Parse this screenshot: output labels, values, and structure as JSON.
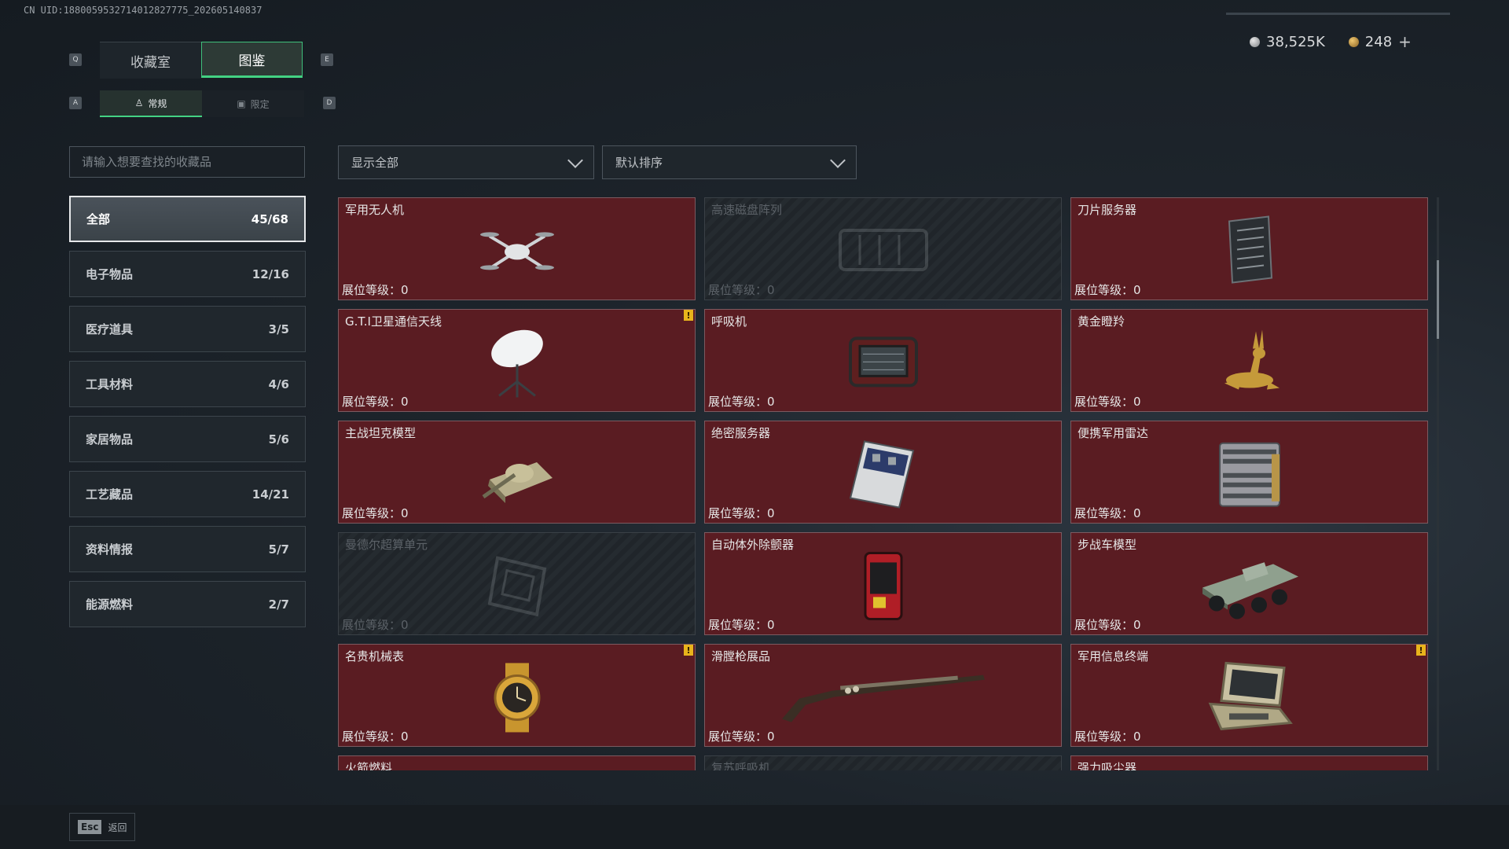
{
  "uid": "CN UID:1880059532714012827775_202605140837",
  "currency": {
    "silver": "38,525K",
    "gold": "248",
    "add": "+"
  },
  "keys": {
    "prev_tab": "Q",
    "next_tab": "E",
    "prev_sub": "A",
    "next_sub": "D"
  },
  "tabs": [
    {
      "label": "收藏室"
    },
    {
      "label": "图鉴"
    }
  ],
  "subtabs": [
    {
      "label": "常规"
    },
    {
      "label": "限定"
    }
  ],
  "search": {
    "placeholder": "请输入想要查找的收藏品"
  },
  "filters": {
    "show": "显示全部",
    "sort": "默认排序"
  },
  "categories": [
    {
      "label": "全部",
      "count": "45/68"
    },
    {
      "label": "电子物品",
      "count": "12/16"
    },
    {
      "label": "医疗道具",
      "count": "3/5"
    },
    {
      "label": "工具材料",
      "count": "4/6"
    },
    {
      "label": "家居物品",
      "count": "5/6"
    },
    {
      "label": "工艺藏品",
      "count": "14/21"
    },
    {
      "label": "资料情报",
      "count": "5/7"
    },
    {
      "label": "能源燃料",
      "count": "2/7"
    }
  ],
  "level_label": "展位等级：",
  "items": [
    {
      "name": "军用无人机",
      "level": "0",
      "icon": "drone-icon"
    },
    {
      "name": "高速磁盘阵列",
      "level": "0",
      "icon": "disk-array-icon"
    },
    {
      "name": "刀片服务器",
      "level": "0",
      "icon": "blade-server-icon"
    },
    {
      "name": "G.T.I卫星通信天线",
      "level": "0",
      "icon": "satellite-dish-icon"
    },
    {
      "name": "呼吸机",
      "level": "0",
      "icon": "ventilator-icon"
    },
    {
      "name": "黄金瞪羚",
      "level": "0",
      "icon": "golden-gazelle-icon"
    },
    {
      "name": "主战坦克模型",
      "level": "0",
      "icon": "tank-icon"
    },
    {
      "name": "绝密服务器",
      "level": "0",
      "icon": "server-icon"
    },
    {
      "name": "便携军用雷达",
      "level": "0",
      "icon": "radar-icon"
    },
    {
      "name": "曼德尔超算单元",
      "level": "0",
      "icon": "compute-unit-icon"
    },
    {
      "name": "自动体外除颤器",
      "level": "0",
      "icon": "defibrillator-icon"
    },
    {
      "name": "步战车模型",
      "level": "0",
      "icon": "ifv-icon"
    },
    {
      "name": "名贵机械表",
      "level": "0",
      "icon": "watch-icon"
    },
    {
      "name": "滑膛枪展品",
      "level": "0",
      "icon": "musket-icon"
    },
    {
      "name": "军用信息终端",
      "level": "0",
      "icon": "terminal-icon"
    },
    {
      "name": "火箭燃料",
      "level": "",
      "icon": "fuel-icon"
    },
    {
      "name": "复苏呼吸机",
      "level": "",
      "icon": "respirator-icon"
    },
    {
      "name": "强力吸尘器",
      "level": "",
      "icon": "vacuum-icon"
    }
  ],
  "alert_mark": "!",
  "back": {
    "key": "Esc",
    "label": "返回"
  }
}
